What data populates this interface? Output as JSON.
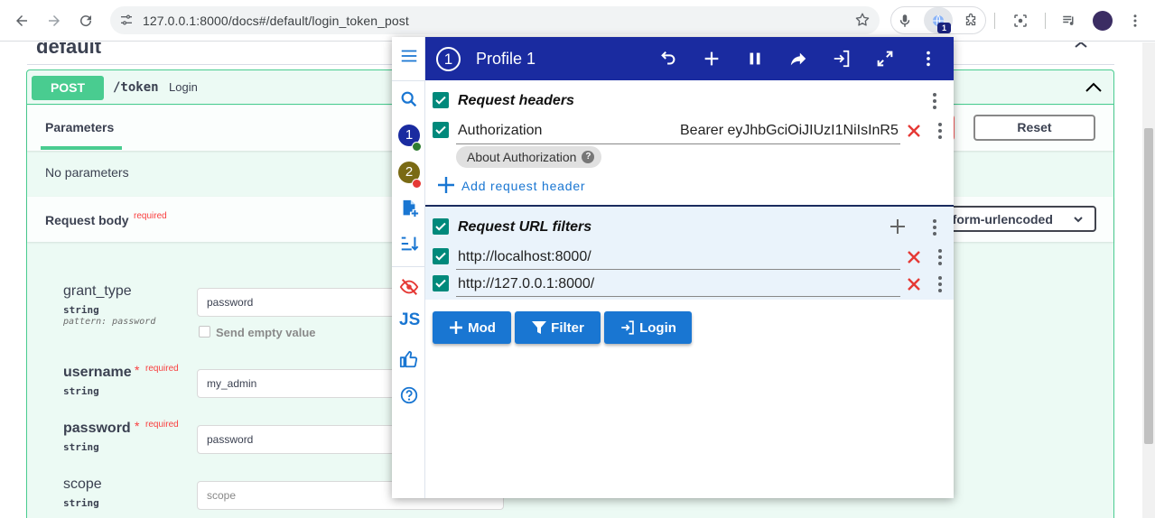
{
  "browser": {
    "url": "127.0.0.1:8000/docs#/default/login_token_post",
    "extension_badge": "1"
  },
  "swagger": {
    "section_title": "default",
    "method": "POST",
    "path": "/token",
    "description": "Login",
    "parameters_tab": "Parameters",
    "reset_label": "Reset",
    "no_parameters": "No parameters",
    "request_body_title": "Request body",
    "required_label": "required",
    "content_type": "-form-urlencoded",
    "fields": [
      {
        "name": "grant_type",
        "type": "string",
        "pattern": "pattern: password",
        "value": "password",
        "placeholder": ""
      },
      {
        "name": "username",
        "type": "string",
        "value": "my_admin",
        "placeholder": ""
      },
      {
        "name": "password",
        "type": "string",
        "value": "password",
        "placeholder": ""
      },
      {
        "name": "scope",
        "type": "string",
        "value": "",
        "placeholder": "scope"
      }
    ],
    "send_empty_value": "Send empty value",
    "required_star": "*"
  },
  "popup": {
    "profile_number": "1",
    "profile_name": "Profile 1",
    "rail_profiles": [
      {
        "number": "1",
        "color": "#1a2ba0",
        "status": "#2e7d32"
      },
      {
        "number": "2",
        "color": "#7a6a14",
        "status": "#e53935"
      }
    ],
    "rail_js_label": "JS",
    "request_headers": {
      "title": "Request headers",
      "rows": [
        {
          "name": "Authorization",
          "value": "Bearer eyJhbGciOiJIUzI1NiIsInR5"
        }
      ],
      "about_chip": "About Authorization",
      "add_label": "Add request header"
    },
    "url_filters": {
      "title": "Request URL filters",
      "rows": [
        "http://localhost:8000/",
        "http://127.0.0.1:8000/"
      ]
    },
    "buttons": {
      "mod": "Mod",
      "filter": "Filter",
      "login": "Login"
    },
    "colors": {
      "header": "#1a2ba0",
      "accent": "#1976d2",
      "checkbox": "#00897b",
      "delete": "#e53935"
    }
  }
}
